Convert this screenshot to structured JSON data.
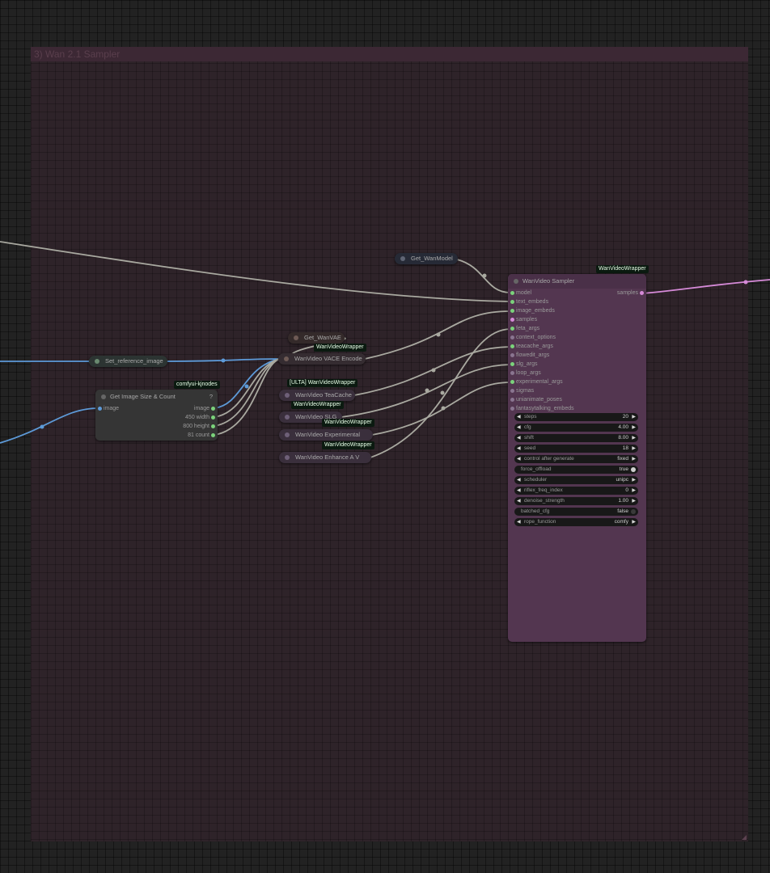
{
  "group": {
    "title": "3) Wan 2.1 Sampler"
  },
  "nodes": {
    "get_wanmodel": {
      "title": "Get_WanModel"
    },
    "get_wanvae": {
      "title": "Get_WanVAE"
    },
    "set_reference_image": {
      "title": "Set_reference_image"
    },
    "get_image_size": {
      "title": "Get Image Size & Count",
      "badge": "comfyui-kjnodes",
      "help": "?",
      "input_image": "image",
      "out_image": "image",
      "out_width": "450 width",
      "out_height": "800 height",
      "out_count": "81 count"
    },
    "vace_encode": {
      "title": "WanVideo VACE Encode",
      "badge": "WanVideoWrapper"
    },
    "teacache": {
      "title": "WanVideo TeaCache",
      "badge": "[ULTA] WanVideoWrapper"
    },
    "slg": {
      "title": "WanVideo SLG",
      "badge": "WanVideoWrapper"
    },
    "experimental": {
      "title": "WanVideo Experimental",
      "badge": "WanVideoWrapper"
    },
    "enhance": {
      "title": "WanVideo Enhance A V",
      "badge": "WanVideoWrapper"
    },
    "sampler": {
      "title": "WanVideo Sampler",
      "badge": "WanVideoWrapper",
      "output": "samples",
      "inputs": [
        "model",
        "text_embeds",
        "image_embeds",
        "samples",
        "feta_args",
        "context_options",
        "teacache_args",
        "flowedit_args",
        "slg_args",
        "loop_args",
        "experimental_args",
        "sigmas",
        "unianimate_poses",
        "fantasytalking_embeds"
      ],
      "widgets": [
        {
          "label": "steps",
          "value": "20",
          "kind": "number"
        },
        {
          "label": "cfg",
          "value": "4.00",
          "kind": "number"
        },
        {
          "label": "shift",
          "value": "8.00",
          "kind": "number"
        },
        {
          "label": "seed",
          "value": "18",
          "kind": "number"
        },
        {
          "label": "control after generate",
          "value": "fixed",
          "kind": "number"
        },
        {
          "label": "force_offload",
          "value": "true",
          "kind": "toggle-on"
        },
        {
          "label": "scheduler",
          "value": "unipc",
          "kind": "number"
        },
        {
          "label": "riflex_freq_index",
          "value": "0",
          "kind": "number"
        },
        {
          "label": "denoise_strength",
          "value": "1.00",
          "kind": "number"
        },
        {
          "label": "batched_cfg",
          "value": "false",
          "kind": "toggle-off"
        },
        {
          "label": "rope_function",
          "value": "comfy",
          "kind": "number"
        }
      ]
    }
  },
  "colors": {
    "image_wire": "#5d9ad8",
    "latent_wire": "#d68ad8",
    "generic_wire": "#a9a9a0",
    "sampler_body": "#533650"
  }
}
